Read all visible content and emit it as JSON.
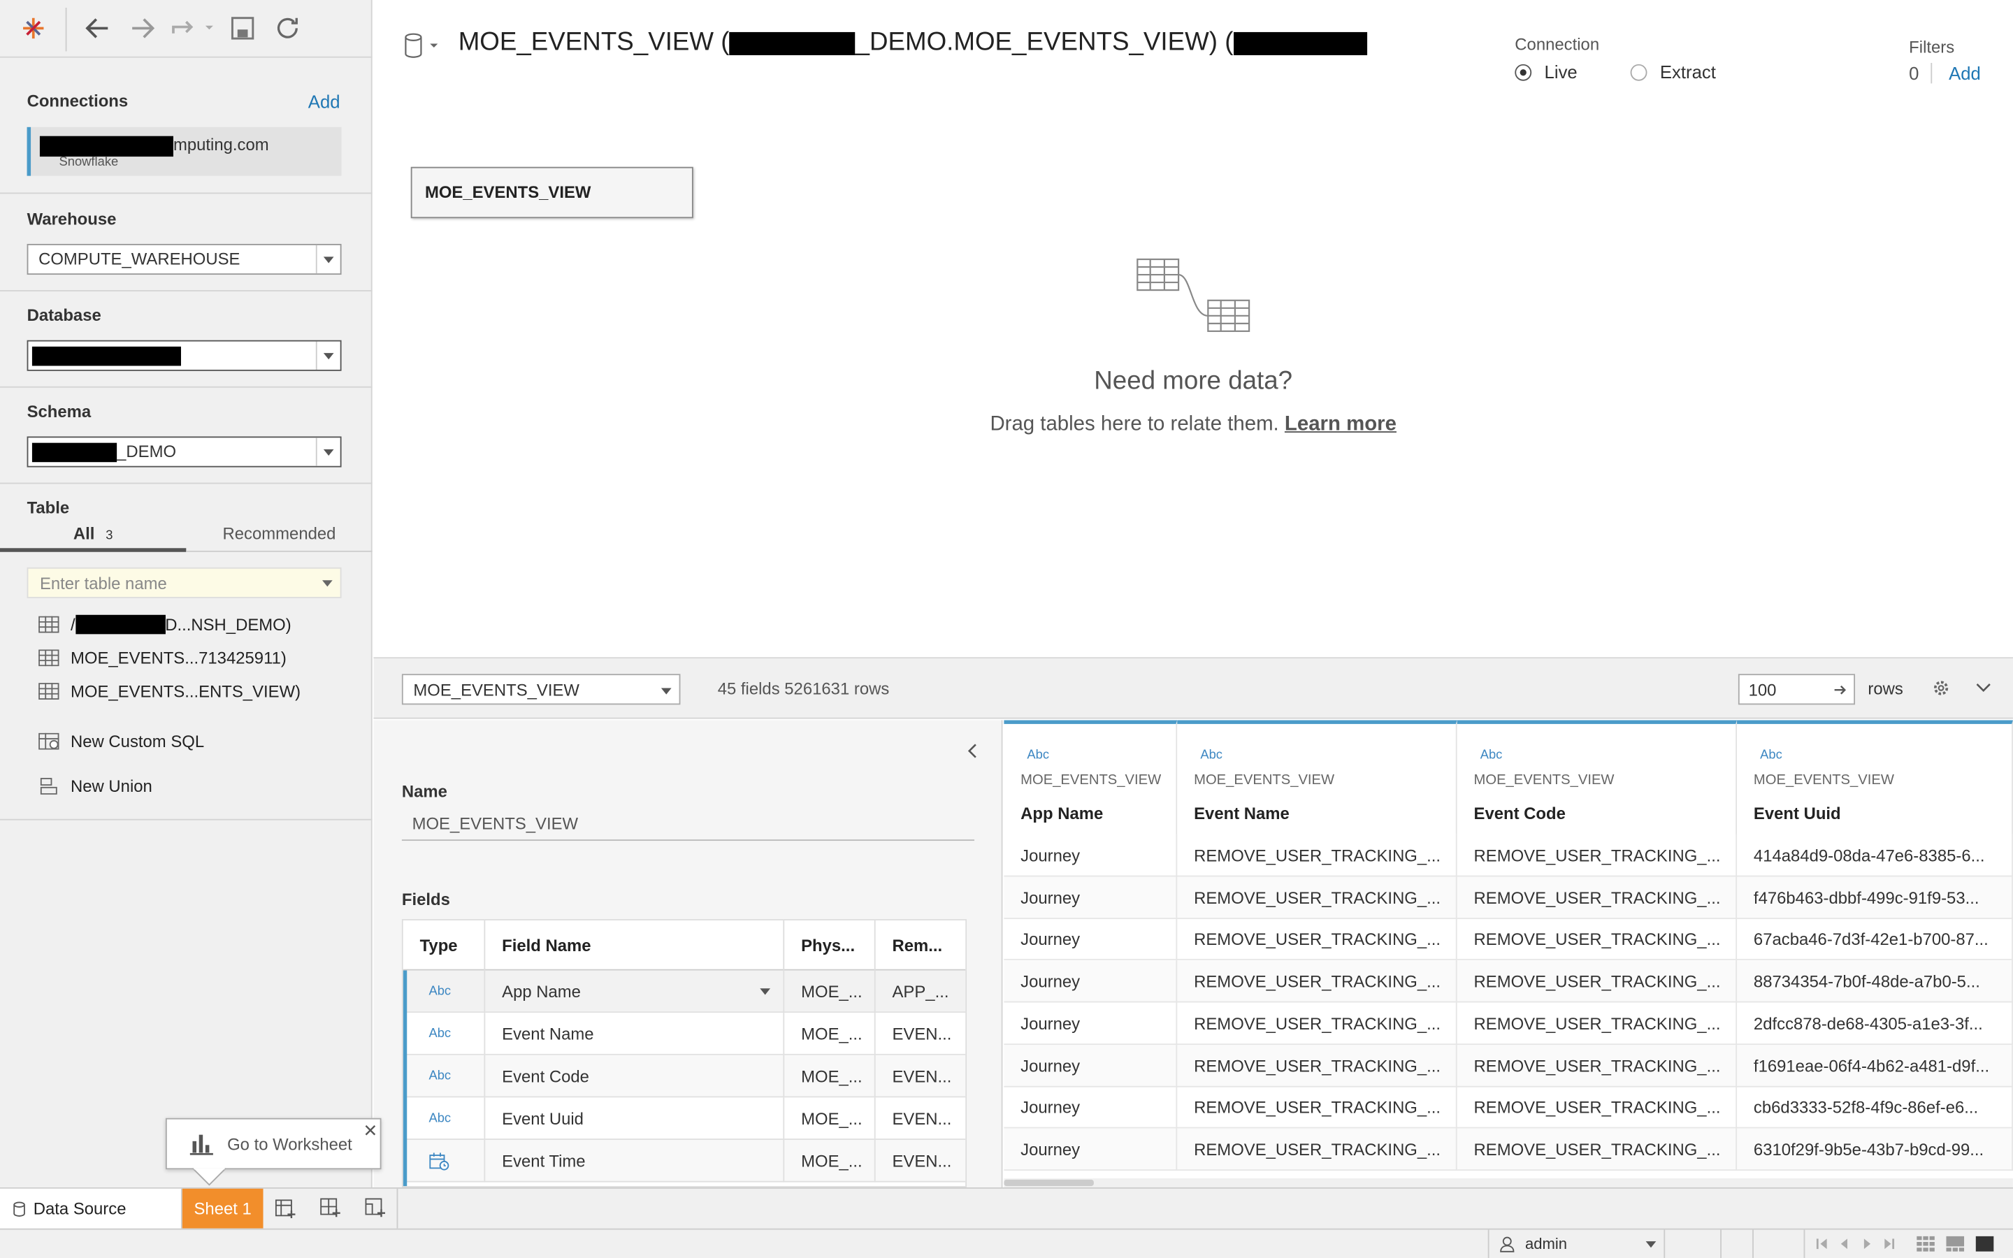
{
  "toolbar": {
    "back_label": "back",
    "forward_label": "forward"
  },
  "connections": {
    "title": "Connections",
    "add_label": "Add",
    "item_visible_text": "mputing.com",
    "item_type": "Snowflake"
  },
  "warehouse": {
    "title": "Warehouse",
    "value": "COMPUTE_WAREHOUSE"
  },
  "database": {
    "title": "Database"
  },
  "schema": {
    "title": "Schema",
    "value_suffix": "_DEMO"
  },
  "table_section": {
    "title": "Table",
    "tab_all": "All",
    "tab_all_count": "3",
    "tab_recommended": "Recommended",
    "search_placeholder": "Enter table name",
    "items": [
      "D...NSH_DEMO)",
      "MOE_EVENTS...713425911)",
      "MOE_EVENTS...ENTS_VIEW)"
    ],
    "custom_sql": "New Custom SQL",
    "new_union": "New Union"
  },
  "header": {
    "title_prefix": "MOE_EVENTS_VIEW (",
    "title_middle": "_DEMO.MOE_EVENTS_VIEW) (",
    "connection_label": "Connection",
    "live_label": "Live",
    "extract_label": "Extract",
    "filters_label": "Filters",
    "filters_count": "0",
    "filters_add": "Add"
  },
  "canvas": {
    "table_box": "MOE_EVENTS_VIEW",
    "need_more": "Need more data?",
    "drag_text": "Drag tables here to relate them.",
    "learn_more": "Learn more"
  },
  "grid_bar": {
    "table_select": "MOE_EVENTS_VIEW",
    "summary": "45 fields 5261631 rows",
    "rows_value": "100",
    "rows_label": "rows"
  },
  "meta": {
    "name_label": "Name",
    "name_value": "MOE_EVENTS_VIEW",
    "fields_label": "Fields",
    "columns": [
      "Type",
      "Field Name",
      "Phys...",
      "Rem..."
    ],
    "rows": [
      {
        "type": "Abc",
        "name": "App Name",
        "phys": "MOE_...",
        "rem": "APP_..."
      },
      {
        "type": "Abc",
        "name": "Event Name",
        "phys": "MOE_...",
        "rem": "EVEN..."
      },
      {
        "type": "Abc",
        "name": "Event Code",
        "phys": "MOE_...",
        "rem": "EVEN..."
      },
      {
        "type": "Abc",
        "name": "Event Uuid",
        "phys": "MOE_...",
        "rem": "EVEN..."
      },
      {
        "type": "datetime-icon",
        "name": "Event Time",
        "phys": "MOE_...",
        "rem": "EVEN..."
      }
    ]
  },
  "grid": {
    "type_label": "Abc",
    "source": "MOE_EVENTS_VIEW",
    "columns": [
      "App Name",
      "Event Name",
      "Event Code",
      "Event Uuid"
    ],
    "rows": [
      [
        "Journey",
        "REMOVE_USER_TRACKING_...",
        "REMOVE_USER_TRACKING_...",
        "414a84d9-08da-47e6-8385-6..."
      ],
      [
        "Journey",
        "REMOVE_USER_TRACKING_...",
        "REMOVE_USER_TRACKING_...",
        "f476b463-dbbf-499c-91f9-53..."
      ],
      [
        "Journey",
        "REMOVE_USER_TRACKING_...",
        "REMOVE_USER_TRACKING_...",
        "67acba46-7d3f-42e1-b700-87..."
      ],
      [
        "Journey",
        "REMOVE_USER_TRACKING_...",
        "REMOVE_USER_TRACKING_...",
        "88734354-7b0f-48de-a7b0-5..."
      ],
      [
        "Journey",
        "REMOVE_USER_TRACKING_...",
        "REMOVE_USER_TRACKING_...",
        "2dfcc878-de68-4305-a1e3-3f..."
      ],
      [
        "Journey",
        "REMOVE_USER_TRACKING_...",
        "REMOVE_USER_TRACKING_...",
        "f1691eae-06f4-4b62-a481-d9f..."
      ],
      [
        "Journey",
        "REMOVE_USER_TRACKING_...",
        "REMOVE_USER_TRACKING_...",
        "cb6d3333-52f8-4f9c-86ef-e6..."
      ],
      [
        "Journey",
        "REMOVE_USER_TRACKING_...",
        "REMOVE_USER_TRACKING_...",
        "6310f29f-9b5e-43b7-b9cd-99..."
      ]
    ]
  },
  "tooltip": {
    "text": "Go to Worksheet"
  },
  "tabs": {
    "data_source": "Data Source",
    "sheet1": "Sheet 1"
  },
  "status": {
    "user": "admin"
  },
  "colors": {
    "accent": "#1f77b4",
    "sheet_tab": "#f28e2b",
    "header_accent": "#4a9bc9"
  }
}
